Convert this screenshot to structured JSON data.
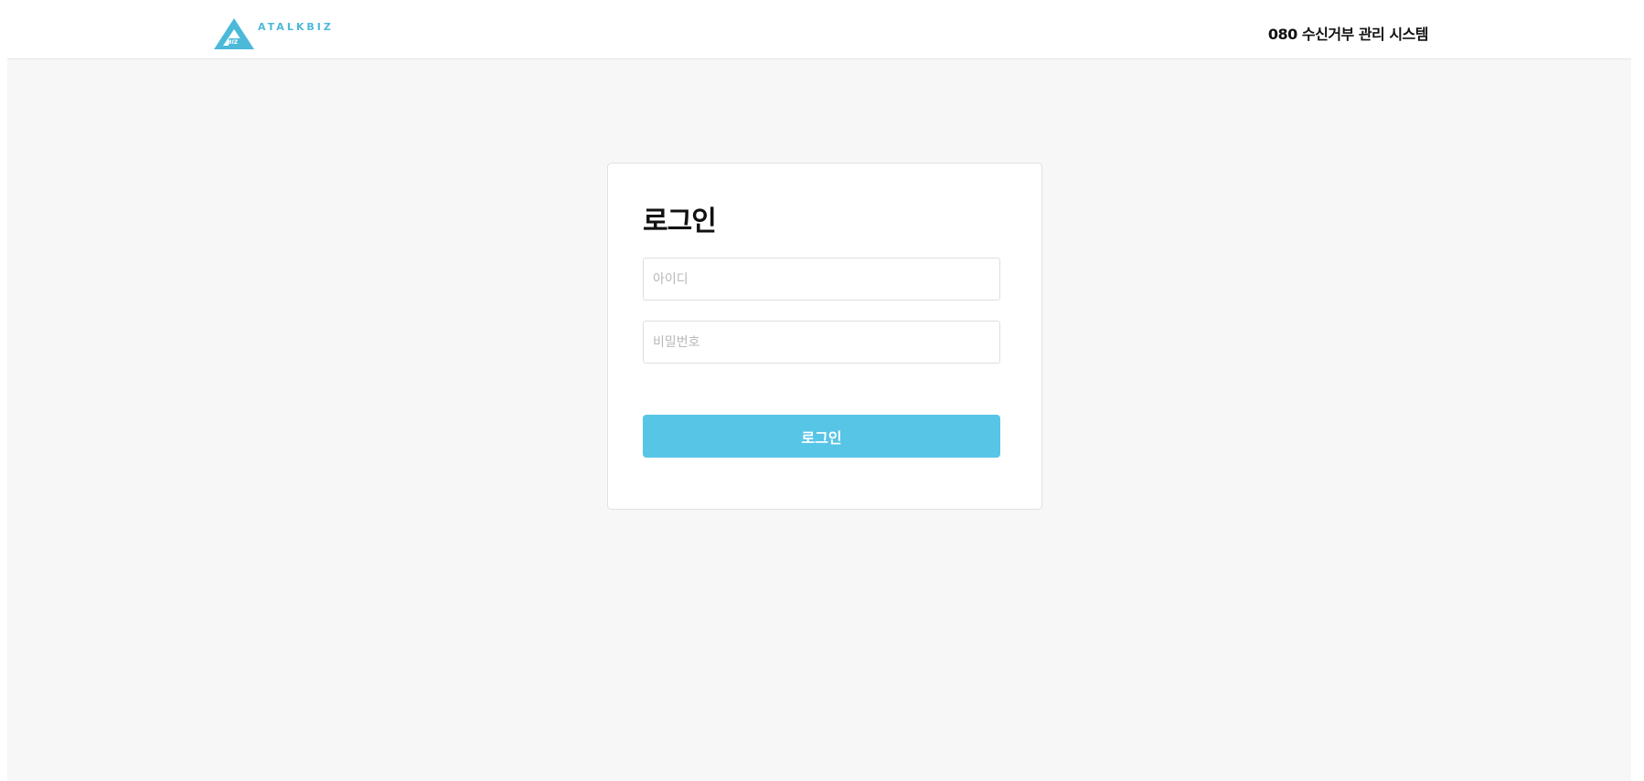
{
  "header": {
    "logo_text": "ATALKBIZ",
    "logo_mark_text": "BIZ",
    "system_title": "080 수신거부 관리 시스템"
  },
  "login": {
    "heading": "로그인",
    "id_placeholder": "아이디",
    "id_value": "",
    "password_placeholder": "비밀번호",
    "password_value": "",
    "button_label": "로그인"
  },
  "colors": {
    "brand": "#4cb9d9",
    "button": "#57c5e6",
    "background": "#f7f7f7"
  }
}
